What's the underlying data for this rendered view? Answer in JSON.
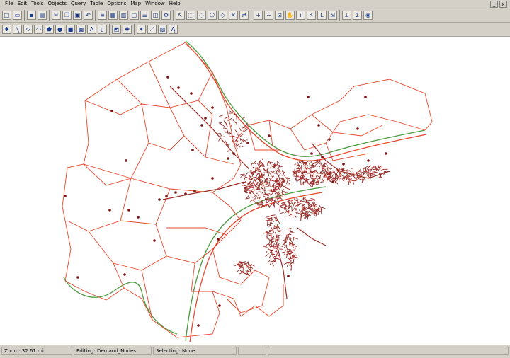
{
  "menu": {
    "items": [
      {
        "label": "File"
      },
      {
        "label": "Edit"
      },
      {
        "label": "Tools"
      },
      {
        "label": "Objects"
      },
      {
        "label": "Query"
      },
      {
        "label": "Table"
      },
      {
        "label": "Options"
      },
      {
        "label": "Map"
      },
      {
        "label": "Window"
      },
      {
        "label": "Help"
      }
    ]
  },
  "window_controls": {
    "minimize": "_",
    "close": "x"
  },
  "toolbar_icons": {
    "row1": [
      "new-icon",
      "open-icon",
      "save-icon",
      "print-icon",
      "cut-icon",
      "copy-icon",
      "paste-icon",
      "undo-icon",
      "layer-control-icon",
      "browser-icon",
      "graph-icon",
      "layout-icon",
      "legend-icon",
      "redistrict-icon",
      "tool-manager-icon",
      "select-arrow-icon",
      "marquee-select-icon",
      "radius-select-icon",
      "polygon-select-icon",
      "boundary-select-icon",
      "unselect-icon",
      "invert-select-icon",
      "zoom-in-icon",
      "zoom-out-icon",
      "change-view-icon",
      "grabber-hand-icon",
      "info-icon",
      "hotlink-icon",
      "label-icon",
      "drag-window-icon",
      "ruler-icon",
      "statistics-icon",
      "map-tool-icon"
    ],
    "row2": [
      "symbol-icon",
      "line-icon",
      "polyline-icon",
      "arc-icon",
      "polygon-icon",
      "ellipse-icon",
      "rectangle-icon",
      "rounded-rect-icon",
      "text-icon",
      "frame-icon",
      "reshape-icon",
      "add-node-icon",
      "symbol-style-icon",
      "line-style-icon",
      "region-style-icon",
      "text-style-icon"
    ]
  },
  "status": {
    "zoom": "Zoom: 32.61 mi",
    "editing": "Editing: Demand_Nodes",
    "selecting": "Selecting: None"
  },
  "map": {
    "boundary_color": "#e8452a",
    "river_color": "#4a9a3e",
    "node_color": "#7a1414",
    "dense_fill": "#9a2a24"
  }
}
